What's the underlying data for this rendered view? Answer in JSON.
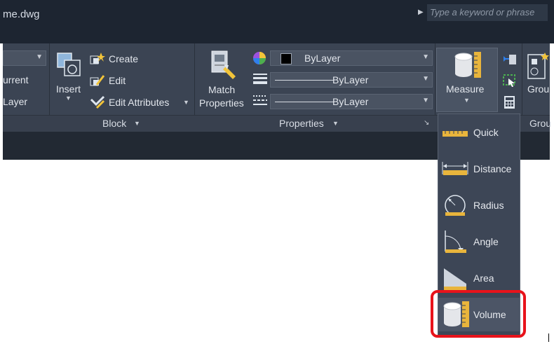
{
  "title": {
    "filename": "me.dwg",
    "search_placeholder": "Type a keyword or phrase"
  },
  "layer_panel": {
    "current_label": "urrent",
    "layer_label": "Layer"
  },
  "block_panel": {
    "insert_label": "Insert",
    "create_label": "Create",
    "edit_label": "Edit",
    "edit_attributes_label": "Edit Attributes",
    "panel_title": "Block"
  },
  "properties_panel": {
    "match_line1": "Match",
    "match_line2": "Properties",
    "color_value": "ByLayer",
    "linetype_value": "ByLayer",
    "lineweight_value": "ByLayer",
    "panel_title": "Properties"
  },
  "utilities_panel": {
    "measure_label": "Measure"
  },
  "groups_panel": {
    "label_top": "Grou",
    "label_bottom": "Grou"
  },
  "measure_menu": {
    "items": [
      {
        "label": "Quick"
      },
      {
        "label": "Distance"
      },
      {
        "label": "Radius"
      },
      {
        "label": "Angle"
      },
      {
        "label": "Area"
      },
      {
        "label": "Volume"
      }
    ],
    "highlighted": "Volume"
  },
  "colors": {
    "ribbon_bg": "#3b4453",
    "title_bg": "#1d2531",
    "highlight": "#e8131b",
    "ruler_yellow": "#e9b53c"
  }
}
